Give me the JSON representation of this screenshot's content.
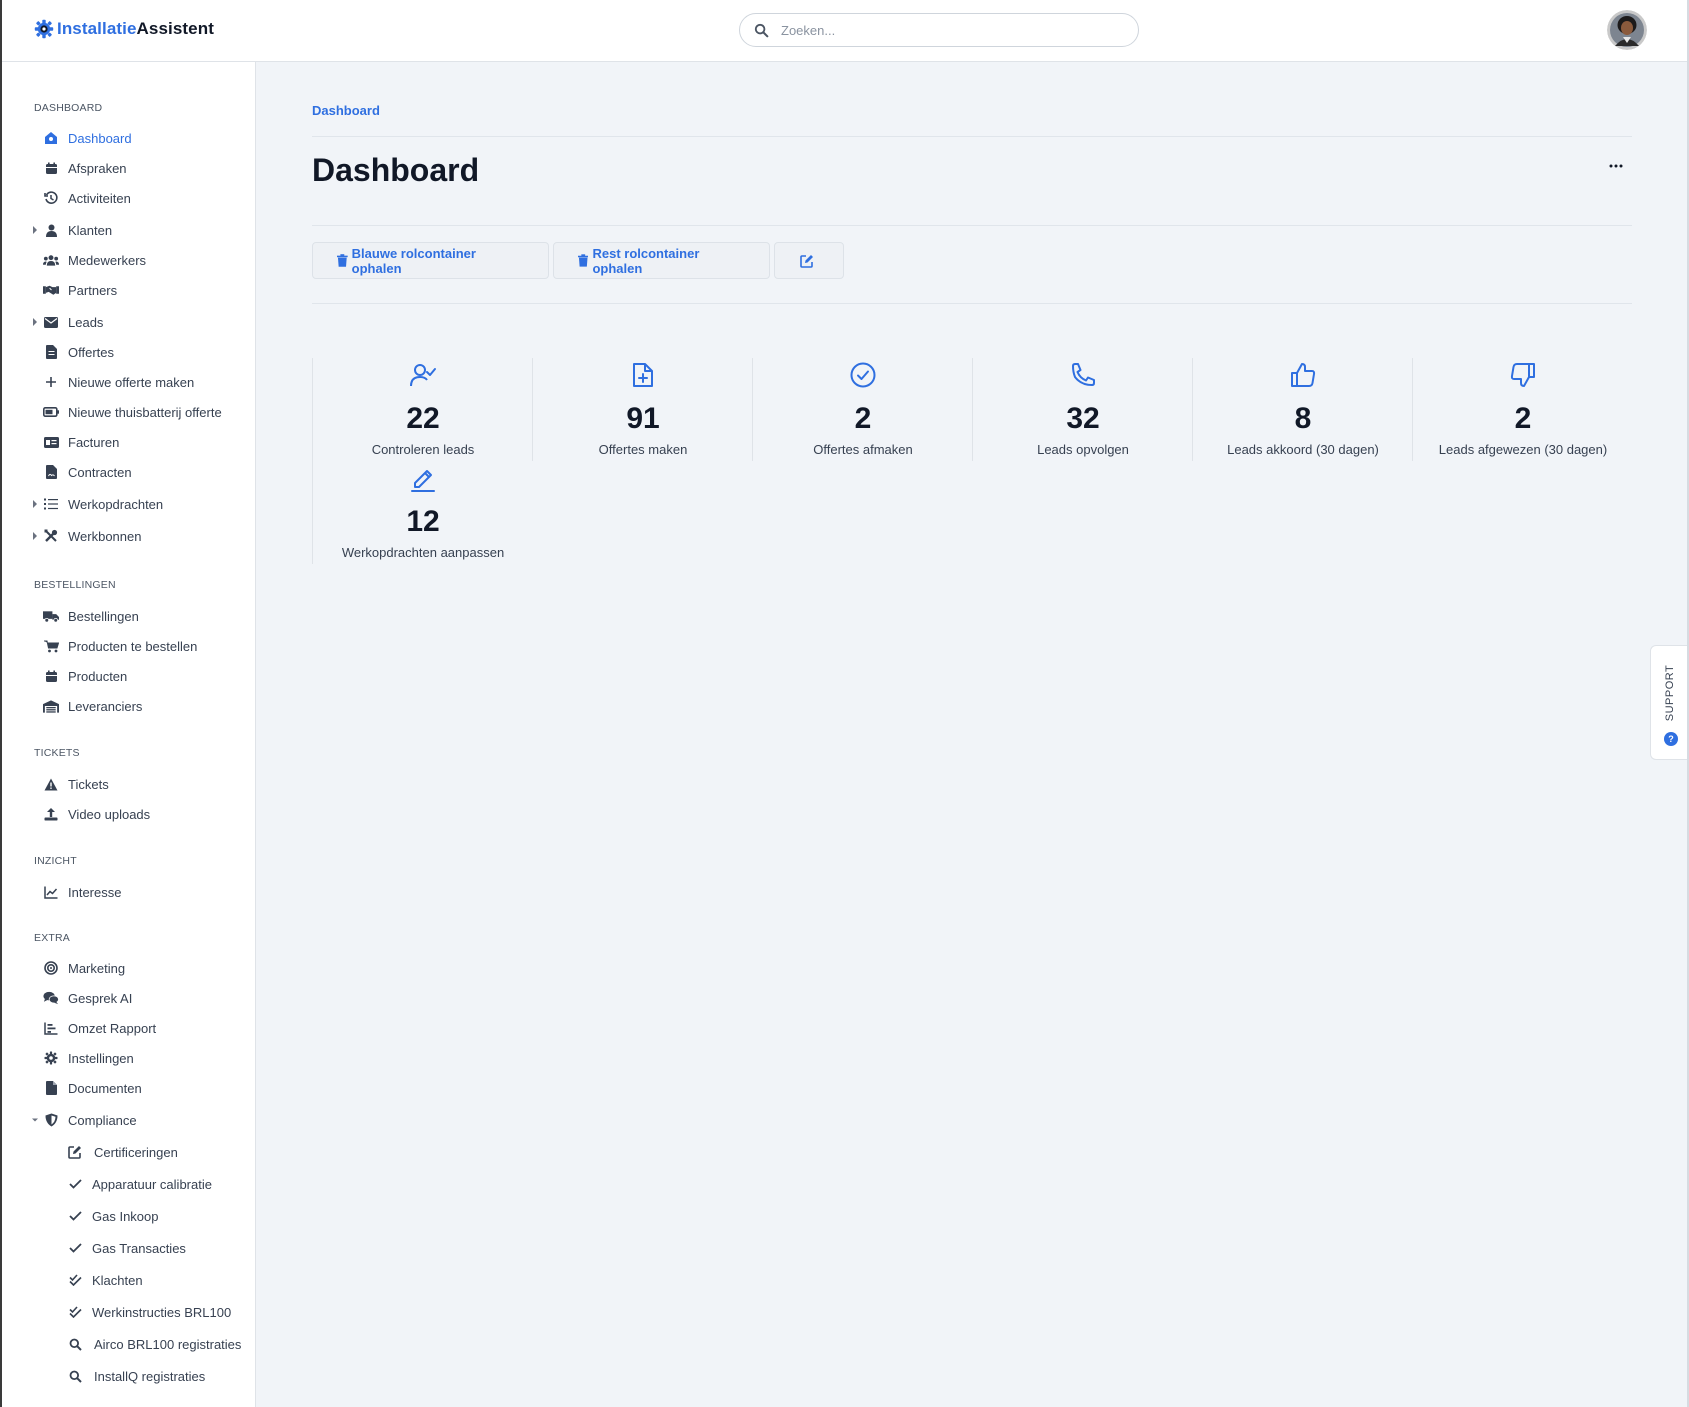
{
  "app": {
    "name_part1": "Installatie",
    "name_part2": "Assistent",
    "search_placeholder": "Zoeken..."
  },
  "sidebar": {
    "sections": {
      "dashboard": "DASHBOARD",
      "bestellingen": "BESTELLINGEN",
      "tickets": "TICKETS",
      "inzicht": "INZICHT",
      "extra": "EXTRA"
    },
    "items": {
      "dashboard": "Dashboard",
      "afspraken": "Afspraken",
      "activiteiten": "Activiteiten",
      "klanten": "Klanten",
      "medewerkers": "Medewerkers",
      "partners": "Partners",
      "leads": "Leads",
      "offertes": "Offertes",
      "nieuwe_offerte": "Nieuwe offerte maken",
      "nieuwe_thuisbatterij": "Nieuwe thuisbatterij offerte",
      "facturen": "Facturen",
      "contracten": "Contracten",
      "werkopdrachten": "Werkopdrachten",
      "werkbonnen": "Werkbonnen",
      "bestellingen": "Bestellingen",
      "producten_te_bestellen": "Producten te bestellen",
      "producten": "Producten",
      "leveranciers": "Leveranciers",
      "tickets": "Tickets",
      "video_uploads": "Video uploads",
      "interesse": "Interesse",
      "marketing": "Marketing",
      "gesprek_ai": "Gesprek AI",
      "omzet_rapport": "Omzet Rapport",
      "instellingen": "Instellingen",
      "documenten": "Documenten",
      "compliance": "Compliance",
      "certificeringen": "Certificeringen",
      "apparatuur_calibratie": "Apparatuur calibratie",
      "gas_inkoop": "Gas Inkoop",
      "gas_transacties": "Gas Transacties",
      "klachten": "Klachten",
      "werkinstructies": "Werkinstructies BRL100",
      "airco": "Airco BRL100 registraties",
      "installq": "InstallQ registraties"
    }
  },
  "main": {
    "breadcrumb": "Dashboard",
    "title": "Dashboard",
    "more": "···",
    "actions": {
      "blauwe": "Blauwe rolcontainer ophalen",
      "rest": "Rest rolcontainer ophalen"
    },
    "stats": [
      {
        "value": "22",
        "label": "Controleren leads",
        "icon": "user-check-icon"
      },
      {
        "value": "91",
        "label": "Offertes maken",
        "icon": "file-plus-icon"
      },
      {
        "value": "2",
        "label": "Offertes afmaken",
        "icon": "check-circle-icon"
      },
      {
        "value": "32",
        "label": "Leads opvolgen",
        "icon": "phone-icon"
      },
      {
        "value": "8",
        "label": "Leads akkoord (30 dagen)",
        "icon": "thumbs-up-icon"
      },
      {
        "value": "2",
        "label": "Leads afgewezen (30 dagen)",
        "icon": "thumbs-down-icon"
      },
      {
        "value": "12",
        "label": "Werkopdrachten aanpassen",
        "icon": "pencil-icon"
      }
    ]
  },
  "support": {
    "label": "SUPPORT"
  },
  "colors": {
    "accent": "#2f6fe0",
    "background": "#f1f4f8",
    "text": "#111827"
  }
}
